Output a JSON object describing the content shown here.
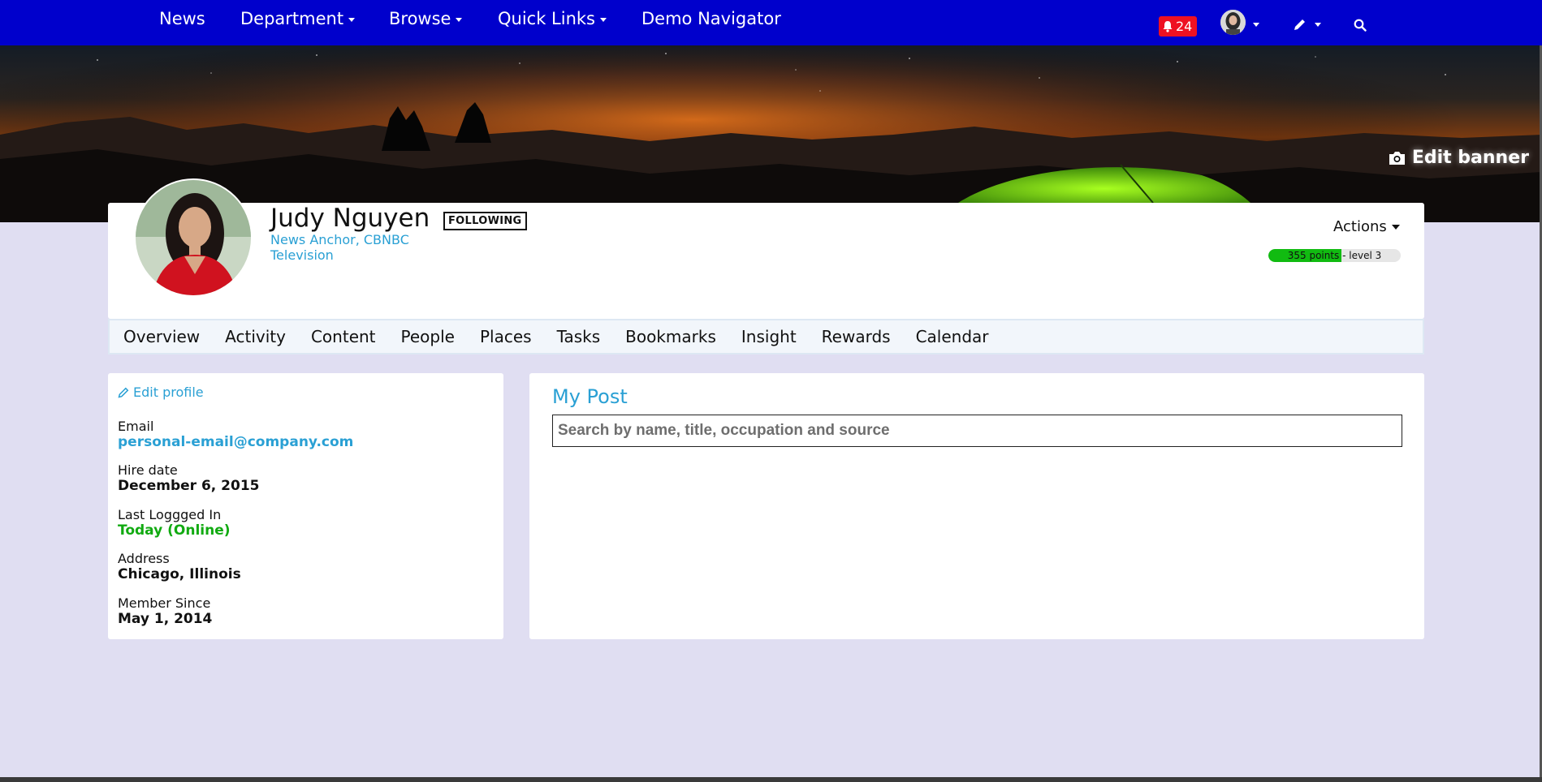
{
  "nav": {
    "items": [
      {
        "label": "News",
        "dropdown": false
      },
      {
        "label": "Department",
        "dropdown": true
      },
      {
        "label": "Browse",
        "dropdown": true
      },
      {
        "label": "Quick Links",
        "dropdown": true
      },
      {
        "label": "Demo Navigator",
        "dropdown": false
      }
    ],
    "notifications_count": "24",
    "icons": [
      "bell-icon",
      "user-avatar",
      "pencil-icon",
      "search-icon"
    ]
  },
  "banner": {
    "edit_label": "Edit banner"
  },
  "profile": {
    "name": "Judy Nguyen",
    "following_label": "FOLLOWING",
    "job_title": "News Anchor, CBNBC Television",
    "actions_label": "Actions",
    "points_text": "355 points - level 3",
    "points_progress": 0.55
  },
  "tabs": [
    "Overview",
    "Activity",
    "Content",
    "People",
    "Places",
    "Tasks",
    "Bookmarks",
    "Insight",
    "Rewards",
    "Calendar"
  ],
  "info": {
    "edit_profile_label": "Edit profile",
    "fields": [
      {
        "label": "Email",
        "value": "personal-email@company.com"
      },
      {
        "label": "Hire date",
        "value": "December 6, 2015"
      },
      {
        "label": "Last Loggged In",
        "value": "Today (Online)"
      },
      {
        "label": "Address",
        "value": "Chicago, Illinois"
      },
      {
        "label": "Member Since",
        "value": "May 1, 2014"
      }
    ]
  },
  "post": {
    "title": "My Post",
    "search_placeholder": "Search by name, title, occupation and source"
  },
  "colors": {
    "nav_bg": "#0000cc",
    "accent": "#2aa0d4",
    "online": "#11aa11",
    "badge": "#ee1122",
    "page_bg": "#e0def2"
  }
}
